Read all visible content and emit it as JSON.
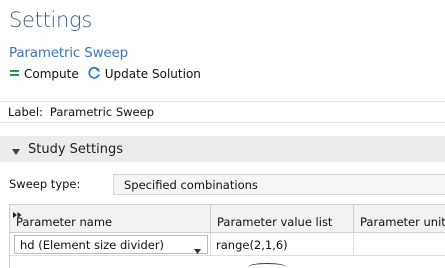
{
  "header": {
    "title": "Settings",
    "subtitle": "Parametric Sweep"
  },
  "toolbar": {
    "compute_icon": "compute-icon",
    "compute_label": "Compute",
    "update_icon": "refresh-icon",
    "update_label": "Update Solution"
  },
  "label_field": {
    "label": "Label:",
    "value": "Parametric Sweep"
  },
  "section": {
    "icon": "collapse-triangle-icon",
    "title": "Study Settings"
  },
  "sweep": {
    "label": "Sweep type:",
    "selected": "Specified combinations"
  },
  "parameter_table": {
    "expand_icon": "expand-icon",
    "columns": [
      "Parameter name",
      "Parameter value list",
      "Parameter unit"
    ],
    "rows": [
      {
        "name": "hd (Element size divider)",
        "values": "range(2,1,6)",
        "unit": ""
      }
    ]
  },
  "colors": {
    "title": "#3f5f86",
    "subtitle": "#3a78b8",
    "compute_icon": "#1e9d4a",
    "update_icon": "#2f7fd1",
    "section_bg": "#ececec"
  }
}
